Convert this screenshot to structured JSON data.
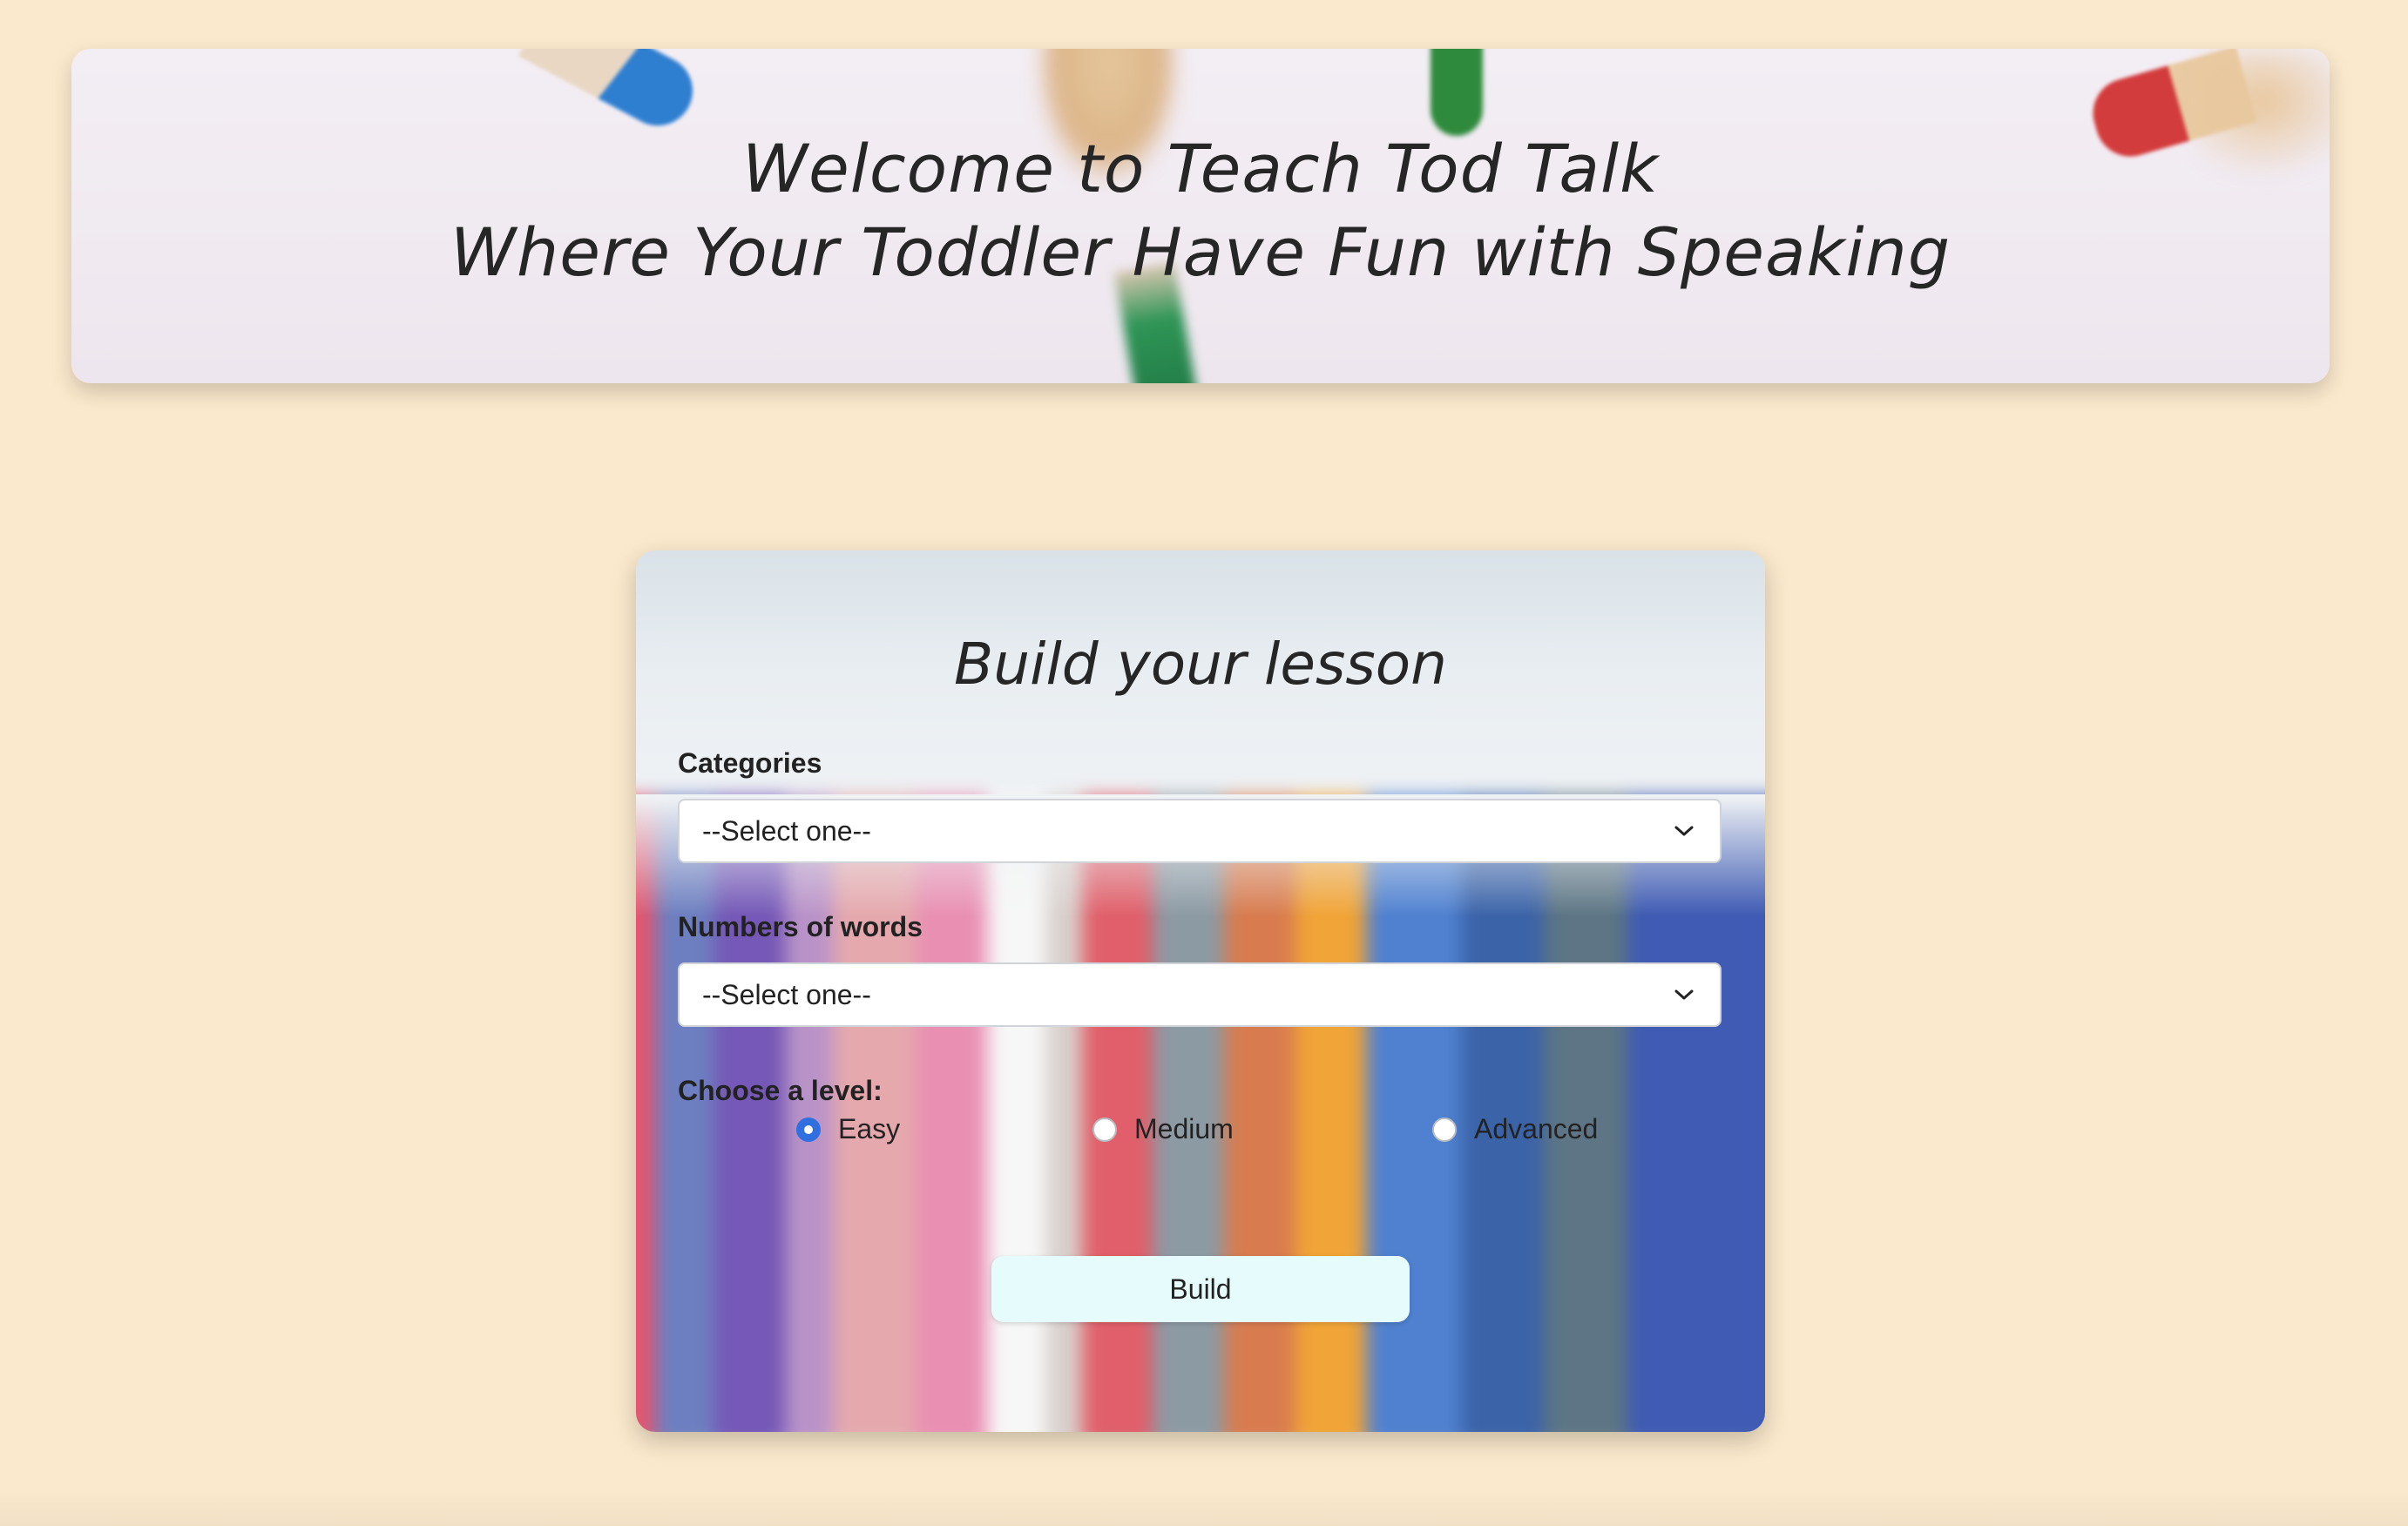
{
  "banner": {
    "line1": "Welcome to Teach Tod Talk",
    "line2": "Where Your Toddler Have Fun with Speaking"
  },
  "lesson_form": {
    "title": "Build your lesson",
    "categories": {
      "label": "Categories",
      "selected": "--Select one--"
    },
    "word_count": {
      "label": "Numbers of words",
      "selected": "--Select one--"
    },
    "level": {
      "label": "Choose a level:",
      "options": [
        {
          "label": "Easy",
          "checked": true
        },
        {
          "label": "Medium",
          "checked": false
        },
        {
          "label": "Advanced",
          "checked": false
        }
      ]
    },
    "build_label": "Build"
  },
  "colors": {
    "page_background": "#fbe9cd",
    "radio_selected": "#2f6fe0",
    "build_button": "#e6fbfb"
  },
  "icons": {
    "select_chevron": "chevron-down-icon"
  }
}
